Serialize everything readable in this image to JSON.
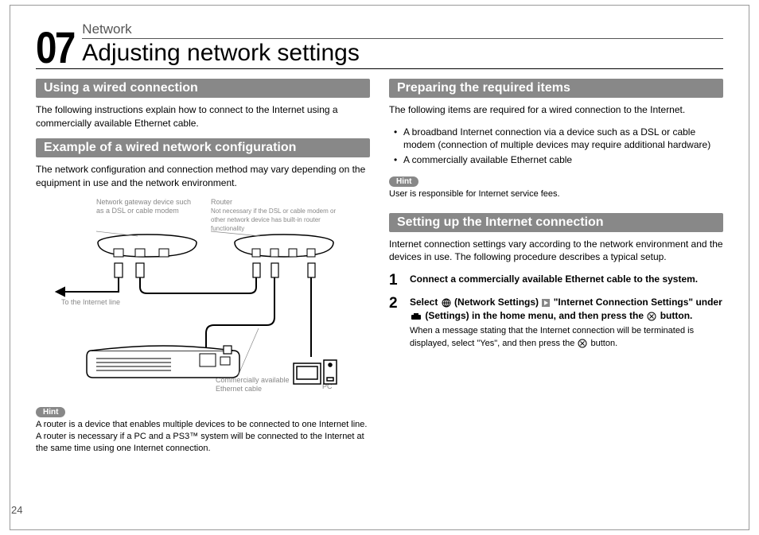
{
  "chapter": {
    "number": "07",
    "category": "Network",
    "title": "Adjusting network settings"
  },
  "left": {
    "section1": {
      "title": "Using a wired connection",
      "body": "The following instructions explain how to connect to the Internet using a commercially available Ethernet cable."
    },
    "section2": {
      "title": "Example of a wired network configuration",
      "body": "The network configuration and connection method may vary depending on the equipment in use and the network environment."
    },
    "diagram": {
      "label_gateway": "Network gateway device such as a DSL or cable modem",
      "label_router_title": "Router",
      "label_router_body": "Not necessary if the DSL or cable modem or other network device has built-in router functionality",
      "label_internet": "To the Internet line",
      "label_cable": "Commercially available Ethernet cable",
      "label_pc": "PC"
    },
    "hint": {
      "badge": "Hint",
      "text": "A router is a device that enables multiple devices to be connected to one Internet line. A router is necessary if a PC and a PS3™ system will be connected to the Internet at the same time using one Internet connection."
    }
  },
  "right": {
    "section1": {
      "title": "Preparing the required items",
      "body": "The following items are required for a wired connection to the Internet.",
      "bullets": {
        "b1": "A broadband Internet connection via a device such as a DSL or cable modem (connection of multiple devices may require additional hardware)",
        "b2": "A commercially available Ethernet cable"
      }
    },
    "hint1": {
      "badge": "Hint",
      "text": "User is responsible for Internet service fees."
    },
    "section2": {
      "title": "Setting up the Internet connection",
      "body": "Internet connection settings vary according to the network environment and the devices in use. The following procedure describes a typical setup."
    },
    "steps": {
      "s1": {
        "num": "1",
        "title": "Connect a commercially available Ethernet cable to the system."
      },
      "s2": {
        "num": "2",
        "title_a": "Select ",
        "title_b": " (Network Settings) ",
        "title_c": " \"Internet Connection Settings\" under ",
        "title_d": " (Settings) in the home menu, and then press the ",
        "title_e": " button.",
        "note_a": "When a message stating that the Internet connection will be terminated is displayed, select \"Yes\", and then press the ",
        "note_b": " button."
      }
    }
  },
  "page_number": "24"
}
